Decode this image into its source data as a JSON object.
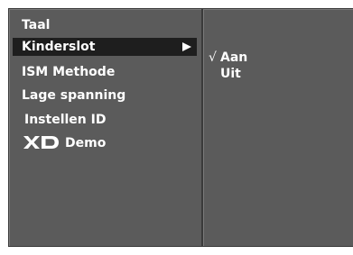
{
  "menu": {
    "items": [
      {
        "label": "Taal"
      },
      {
        "label": "Kinderslot",
        "selected": true,
        "icon": "right-arrow-icon"
      },
      {
        "label": "ISM Methode"
      },
      {
        "label": "Lage spanning"
      },
      {
        "label": "Instellen ID"
      },
      {
        "label": "Demo",
        "logo_text": "XD"
      }
    ]
  },
  "submenu": {
    "options": [
      {
        "label": "Aan",
        "checked": true,
        "icon": "check-icon"
      },
      {
        "label": "Uit",
        "checked": false
      }
    ]
  },
  "colors": {
    "panel": "#5b5b5b",
    "selected": "#1e1e1e",
    "text": "#ffffff"
  }
}
